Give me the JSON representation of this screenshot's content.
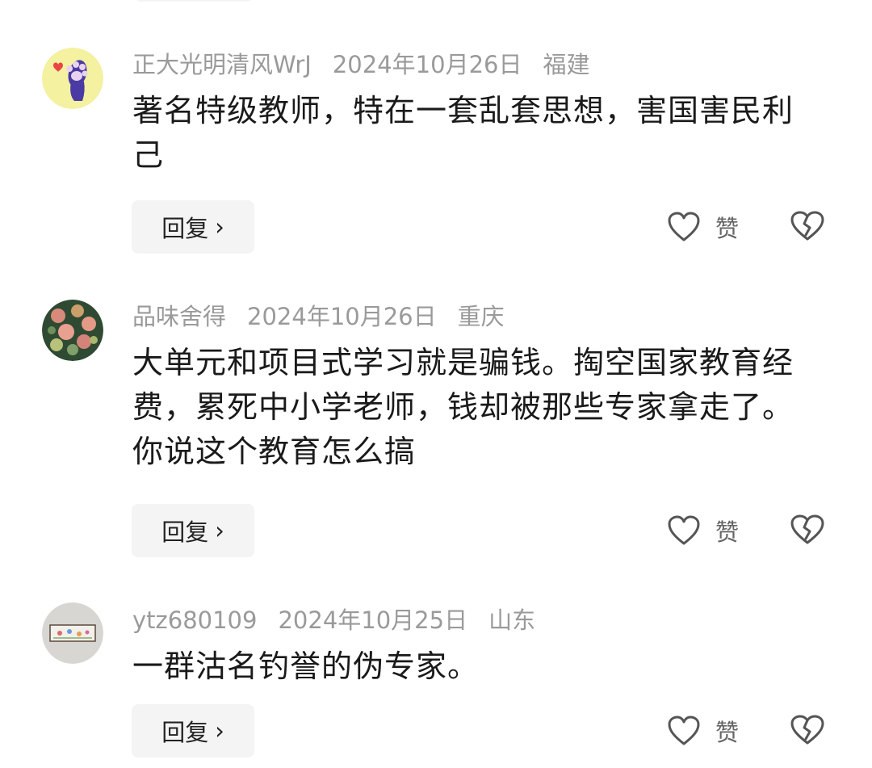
{
  "comments": [
    {
      "username": "正大光明清风WrJ",
      "date": "2024年10月26日",
      "location": "福建",
      "text": "著名特级教师，特在一套乱套思想，害国害民利己",
      "avatar_icon": "paw-icon",
      "reply_label": "回复",
      "like_label": "赞"
    },
    {
      "username": "品味舍得",
      "date": "2024年10月26日",
      "location": "重庆",
      "text": "大单元和项目式学习就是骗钱。掏空国家教育经费，累死中小学老师，钱却被那些专家拿走了。你说这个教育怎么搞",
      "avatar_icon": "flower-photo-icon",
      "reply_label": "回复",
      "like_label": "赞"
    },
    {
      "username": "ytz680109",
      "date": "2024年10月25日",
      "location": "山东",
      "text": "一群沽名钓誉的伪专家。",
      "avatar_icon": "painting-photo-icon",
      "reply_label": "回复",
      "like_label": "赞"
    }
  ],
  "colors": {
    "meta_text": "#9a9a9a",
    "body_text": "#1a1a1a",
    "reply_bg": "#f4f4f4",
    "icon_stroke": "#555555"
  }
}
